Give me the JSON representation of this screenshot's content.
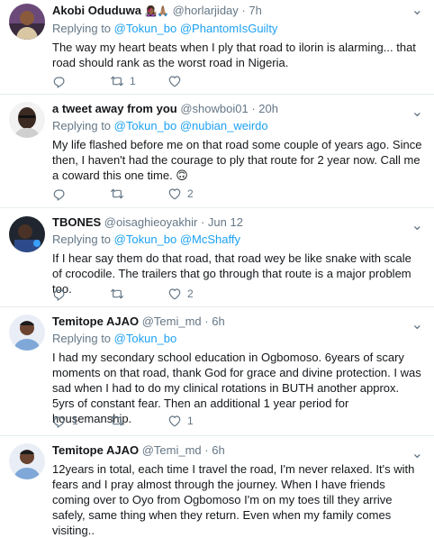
{
  "tweets": [
    {
      "name": "Akobi Oduduwa",
      "name_emoji": "👩🏾‍🎤🙏🏽",
      "handle": "@horlarjiday",
      "sep": "·",
      "time": "7h",
      "replying_prefix": "Replying to",
      "replying_to": "@Tokun_bo @PhantomIsGuilty",
      "text": "The way my heart beats when I ply that road to ilorin is alarming... that road should rank as the worst road in Nigeria.",
      "retweets": "1",
      "likes": ""
    },
    {
      "name": "a tweet away from you",
      "name_emoji": "",
      "handle": "@showboi01",
      "sep": "·",
      "time": "20h",
      "replying_prefix": "Replying to",
      "replying_to": "@Tokun_bo @nubian_weirdo",
      "text": "My life flashed before me on that road some couple of years ago. Since then, I haven't had the courage to ply that route for 2 year now. Call me a coward this one time. 🙃",
      "retweets": "",
      "likes": "2"
    },
    {
      "name": "TBONES",
      "name_emoji": "",
      "handle": "@oisaghieoyakhir",
      "sep": "·",
      "time": "Jun 12",
      "replying_prefix": "Replying to",
      "replying_to": "@Tokun_bo @McShaffy",
      "text": "If I hear say them do that road, that road wey be like snake with scale of crocodile. The trailers that go through that route is a major problem too.",
      "retweets": "",
      "likes": "2"
    },
    {
      "name": "Temitope AJAO",
      "name_emoji": "",
      "handle": "@Temi_md",
      "sep": "·",
      "time": "6h",
      "replying_prefix": "Replying to",
      "replying_to": "@Tokun_bo",
      "text": "I had my secondary school education in Ogbomoso. 6years of scary moments on that road, thank God for grace and divine protection. I was sad when I had to do my clinical rotations in BUTH another approx. 5yrs of constant fear. Then an additional 1 year period for housemanship.",
      "replies": "1",
      "retweets": "",
      "likes": "1"
    },
    {
      "name": "Temitope AJAO",
      "name_emoji": "",
      "handle": "@Temi_md",
      "sep": "·",
      "time": "6h",
      "text": "12years in total, each time I travel the road, I'm never relaxed. It's with fears and I pray almost through the journey. When I have friends coming over to Oyo from Ogbomoso I'm on my toes till they arrive safely, same thing when they return. Even when my family comes visiting.."
    }
  ],
  "caret_glyph": "⌄",
  "colors": {
    "link": "#1da1f2",
    "muted": "#657786",
    "divider": "#e6ecf0"
  }
}
